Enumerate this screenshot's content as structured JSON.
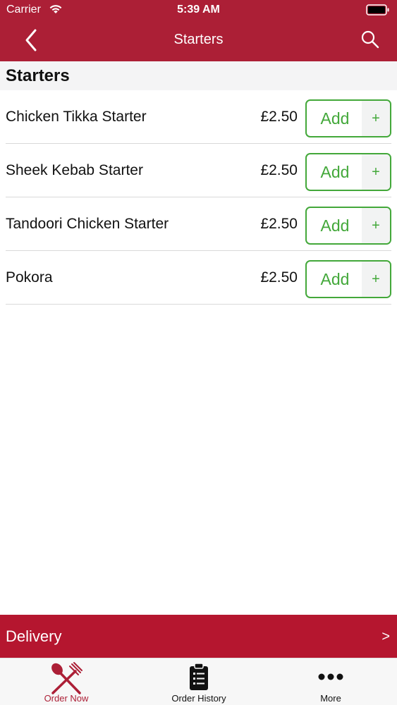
{
  "status_bar": {
    "carrier": "Carrier",
    "time": "5:39 AM"
  },
  "nav": {
    "title": "Starters",
    "back_icon": "chevron-left-icon",
    "search_icon": "search-icon"
  },
  "section": {
    "title": "Starters"
  },
  "items": [
    {
      "name": "Chicken Tikka Starter",
      "price": "£2.50",
      "add_label": "Add",
      "plus": "+"
    },
    {
      "name": "Sheek Kebab Starter",
      "price": "£2.50",
      "add_label": "Add",
      "plus": "+"
    },
    {
      "name": "Tandoori Chicken Starter",
      "price": "£2.50",
      "add_label": "Add",
      "plus": "+"
    },
    {
      "name": "Pokora",
      "price": "£2.50",
      "add_label": "Add",
      "plus": "+"
    }
  ],
  "delivery": {
    "label": "Delivery",
    "chevron": ">"
  },
  "tabs": [
    {
      "label": "Order Now",
      "icon": "fork-spoon-icon",
      "active": true
    },
    {
      "label": "Order History",
      "icon": "clipboard-list-icon",
      "active": false
    },
    {
      "label": "More",
      "icon": "more-dots-icon",
      "active": false
    }
  ],
  "colors": {
    "brand": "#ac1f36",
    "delivery": "#b5162f",
    "add_green": "#43a83a"
  }
}
